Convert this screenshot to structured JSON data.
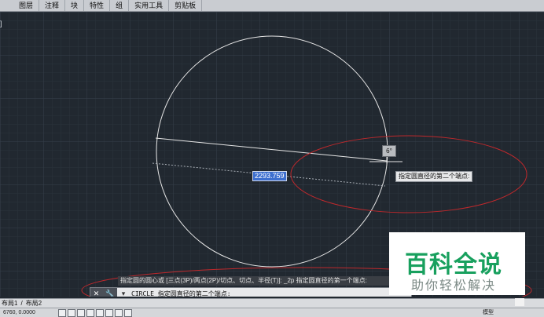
{
  "ribbon": {
    "tabs": [
      "图层",
      "注释",
      "块",
      "特性",
      "组",
      "实用工具",
      "剪贴板"
    ]
  },
  "viewport": {
    "label": "]"
  },
  "drawing": {
    "angle_tooltip": "6°",
    "dimension_input": "2293.759",
    "prompt_tooltip": "指定圆直径的第二个端点:"
  },
  "command": {
    "history": "指定圆的圆心或 [三点(3P)/两点(2P)/切点、切点、半径(T)]: _2p 指定圆直径的第一个端点:",
    "current": "CIRCLE 指定圆直径的第二个端点:",
    "recent_glyph": "▾"
  },
  "layout_tabs": [
    "布局1",
    "布局2"
  ],
  "layout_separator": "/",
  "status": {
    "coords": "6760, 0.0000",
    "model_label": "模型"
  },
  "watermark": {
    "title": "百科全说",
    "subtitle": "助你轻松解决"
  },
  "colors": {
    "canvas": "#212830",
    "annotation_red": "#c0282c",
    "watermark_green": "#18a05e"
  }
}
